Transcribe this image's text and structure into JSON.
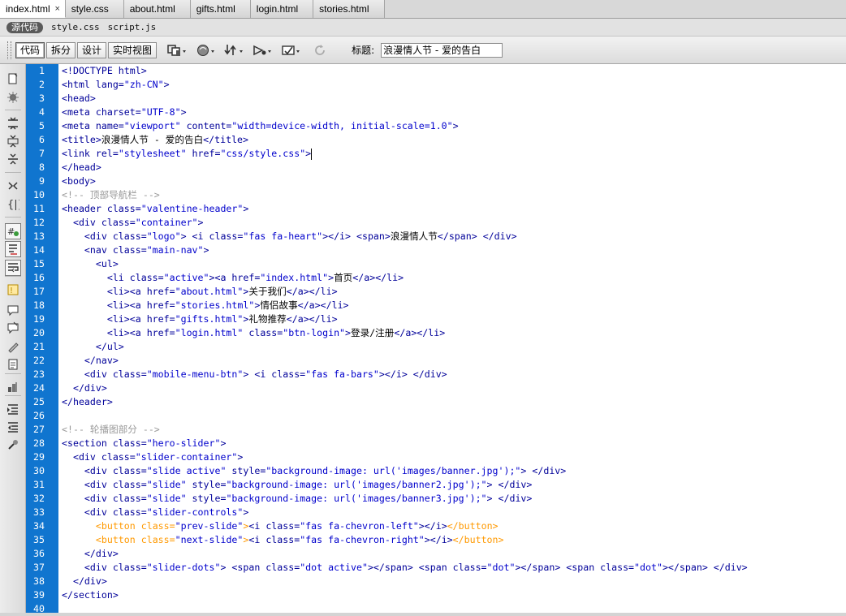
{
  "tabs": [
    {
      "label": "index.html",
      "active": true,
      "close": "×"
    },
    {
      "label": "style.css",
      "active": false
    },
    {
      "label": "about.html",
      "active": false
    },
    {
      "label": "gifts.html",
      "active": false
    },
    {
      "label": "login.html",
      "active": false
    },
    {
      "label": "stories.html",
      "active": false
    }
  ],
  "related_files": {
    "source_label": "源代码",
    "files": [
      "style.css",
      "script.js"
    ]
  },
  "toolbar": {
    "view_buttons": [
      "代码",
      "拆分",
      "设计",
      "实时视图"
    ],
    "active_view": "代码",
    "icons": [
      "multiscreen-icon",
      "preview-browser-icon",
      "file-management-icon",
      "visual-aids-icon",
      "validate-icon",
      "refresh-icon"
    ],
    "title_label": "标题:",
    "title_value": "浪漫情人节 - 爱的告白"
  },
  "sidebar_icons": [
    "open-documents-icon",
    "collapse-tag-icon",
    "collapse-selection-icon",
    "expand-all-icon",
    "expand-collapse-icon",
    "select-parent-tag-icon",
    "balance-braces-icon",
    "line-numbers-icon",
    "highlight-invalid-icon",
    "word-wrap-icon",
    "syntax-error-icon",
    "apply-comment-icon",
    "remove-comment-icon",
    "wrap-tag-icon",
    "recent-snippets-icon",
    "move-css-icon",
    "indent-icon",
    "outdent-icon",
    "format-source-icon"
  ],
  "colors": {
    "gutter": "#1075cf",
    "tag": "#000099",
    "attr_value": "#0000cc",
    "comment": "#999999",
    "form_tag": "#ff9900"
  },
  "code_lines": [
    [
      [
        "tag",
        "<!DOCTYPE html>"
      ]
    ],
    [
      [
        "tag",
        "<html lang="
      ],
      [
        "val",
        "\"zh-CN\""
      ],
      [
        "tag",
        ">"
      ]
    ],
    [
      [
        "tag",
        "<head>"
      ]
    ],
    [
      [
        "tag",
        "<meta charset="
      ],
      [
        "val",
        "\"UTF-8\""
      ],
      [
        "tag",
        ">"
      ]
    ],
    [
      [
        "tag",
        "<meta name="
      ],
      [
        "val",
        "\"viewport\""
      ],
      [
        "tag",
        " content="
      ],
      [
        "val",
        "\"width=device-width, initial-scale=1.0\""
      ],
      [
        "tag",
        ">"
      ]
    ],
    [
      [
        "tag",
        "<title>"
      ],
      [
        "txt",
        "浪漫情人节 - 爱的告白"
      ],
      [
        "tag",
        "</title>"
      ]
    ],
    [
      [
        "tag",
        "<link rel="
      ],
      [
        "val",
        "\"stylesheet\""
      ],
      [
        "tag",
        " href="
      ],
      [
        "val",
        "\"css/style.css\""
      ],
      [
        "tag",
        ">"
      ]
    ],
    [
      [
        "tag",
        "</head>"
      ]
    ],
    [
      [
        "tag",
        "<body>"
      ]
    ],
    [
      [
        "cmt",
        "<!-- 顶部导航栏 -->"
      ]
    ],
    [
      [
        "tag",
        "<header class="
      ],
      [
        "val",
        "\"valentine-header\""
      ],
      [
        "tag",
        ">"
      ]
    ],
    [
      [
        "txt",
        "  "
      ],
      [
        "tag",
        "<div class="
      ],
      [
        "val",
        "\"container\""
      ],
      [
        "tag",
        ">"
      ]
    ],
    [
      [
        "txt",
        "    "
      ],
      [
        "tag",
        "<div class="
      ],
      [
        "val",
        "\"logo\""
      ],
      [
        "tag",
        "> <i class="
      ],
      [
        "val",
        "\"fas fa-heart\""
      ],
      [
        "tag",
        "></i> <span>"
      ],
      [
        "txt",
        "浪漫情人节"
      ],
      [
        "tag",
        "</span> </div>"
      ]
    ],
    [
      [
        "txt",
        "    "
      ],
      [
        "tag",
        "<nav class="
      ],
      [
        "val",
        "\"main-nav\""
      ],
      [
        "tag",
        ">"
      ]
    ],
    [
      [
        "txt",
        "      "
      ],
      [
        "tag",
        "<ul>"
      ]
    ],
    [
      [
        "txt",
        "        "
      ],
      [
        "tag",
        "<li class="
      ],
      [
        "val",
        "\"active\""
      ],
      [
        "tag",
        "><a href="
      ],
      [
        "val",
        "\"index.html\""
      ],
      [
        "tag",
        ">"
      ],
      [
        "txt",
        "首页"
      ],
      [
        "tag",
        "</a></li>"
      ]
    ],
    [
      [
        "txt",
        "        "
      ],
      [
        "tag",
        "<li><a href="
      ],
      [
        "val",
        "\"about.html\""
      ],
      [
        "tag",
        ">"
      ],
      [
        "txt",
        "关于我们"
      ],
      [
        "tag",
        "</a></li>"
      ]
    ],
    [
      [
        "txt",
        "        "
      ],
      [
        "tag",
        "<li><a href="
      ],
      [
        "val",
        "\"stories.html\""
      ],
      [
        "tag",
        ">"
      ],
      [
        "txt",
        "情侣故事"
      ],
      [
        "tag",
        "</a></li>"
      ]
    ],
    [
      [
        "txt",
        "        "
      ],
      [
        "tag",
        "<li><a href="
      ],
      [
        "val",
        "\"gifts.html\""
      ],
      [
        "tag",
        ">"
      ],
      [
        "txt",
        "礼物推荐"
      ],
      [
        "tag",
        "</a></li>"
      ]
    ],
    [
      [
        "txt",
        "        "
      ],
      [
        "tag",
        "<li><a href="
      ],
      [
        "val",
        "\"login.html\""
      ],
      [
        "tag",
        " class="
      ],
      [
        "val",
        "\"btn-login\""
      ],
      [
        "tag",
        ">"
      ],
      [
        "txt",
        "登录/注册"
      ],
      [
        "tag",
        "</a></li>"
      ]
    ],
    [
      [
        "txt",
        "      "
      ],
      [
        "tag",
        "</ul>"
      ]
    ],
    [
      [
        "txt",
        "    "
      ],
      [
        "tag",
        "</nav>"
      ]
    ],
    [
      [
        "txt",
        "    "
      ],
      [
        "tag",
        "<div class="
      ],
      [
        "val",
        "\"mobile-menu-btn\""
      ],
      [
        "tag",
        "> <i class="
      ],
      [
        "val",
        "\"fas fa-bars\""
      ],
      [
        "tag",
        "></i> </div>"
      ]
    ],
    [
      [
        "txt",
        "  "
      ],
      [
        "tag",
        "</div>"
      ]
    ],
    [
      [
        "tag",
        "</header>"
      ]
    ],
    [],
    [
      [
        "cmt",
        "<!-- 轮播图部分 -->"
      ]
    ],
    [
      [
        "tag",
        "<section class="
      ],
      [
        "val",
        "\"hero-slider\""
      ],
      [
        "tag",
        ">"
      ]
    ],
    [
      [
        "txt",
        "  "
      ],
      [
        "tag",
        "<div class="
      ],
      [
        "val",
        "\"slider-container\""
      ],
      [
        "tag",
        ">"
      ]
    ],
    [
      [
        "txt",
        "    "
      ],
      [
        "tag",
        "<div class="
      ],
      [
        "val",
        "\"slide active\""
      ],
      [
        "tag",
        " style="
      ],
      [
        "val",
        "\"background-image: url('images/banner.jpg');\""
      ],
      [
        "tag",
        "> </div>"
      ]
    ],
    [
      [
        "txt",
        "    "
      ],
      [
        "tag",
        "<div class="
      ],
      [
        "val",
        "\"slide\""
      ],
      [
        "tag",
        " style="
      ],
      [
        "val",
        "\"background-image: url('images/banner2.jpg');\""
      ],
      [
        "tag",
        "> </div>"
      ]
    ],
    [
      [
        "txt",
        "    "
      ],
      [
        "tag",
        "<div class="
      ],
      [
        "val",
        "\"slide\""
      ],
      [
        "tag",
        " style="
      ],
      [
        "val",
        "\"background-image: url('images/banner3.jpg');\""
      ],
      [
        "tag",
        "> </div>"
      ]
    ],
    [
      [
        "txt",
        "    "
      ],
      [
        "tag",
        "<div class="
      ],
      [
        "val",
        "\"slider-controls\""
      ],
      [
        "tag",
        ">"
      ]
    ],
    [
      [
        "txt",
        "      "
      ],
      [
        "btn",
        "<button class="
      ],
      [
        "val",
        "\"prev-slide\""
      ],
      [
        "btn",
        ">"
      ],
      [
        "tag",
        "<i class="
      ],
      [
        "val",
        "\"fas fa-chevron-left\""
      ],
      [
        "tag",
        "></i>"
      ],
      [
        "btn",
        "</button>"
      ]
    ],
    [
      [
        "txt",
        "      "
      ],
      [
        "btn",
        "<button class="
      ],
      [
        "val",
        "\"next-slide\""
      ],
      [
        "btn",
        ">"
      ],
      [
        "tag",
        "<i class="
      ],
      [
        "val",
        "\"fas fa-chevron-right\""
      ],
      [
        "tag",
        "></i>"
      ],
      [
        "btn",
        "</button>"
      ]
    ],
    [
      [
        "txt",
        "    "
      ],
      [
        "tag",
        "</div>"
      ]
    ],
    [
      [
        "txt",
        "    "
      ],
      [
        "tag",
        "<div class="
      ],
      [
        "val",
        "\"slider-dots\""
      ],
      [
        "tag",
        "> <span class="
      ],
      [
        "val",
        "\"dot active\""
      ],
      [
        "tag",
        "></span> <span class="
      ],
      [
        "val",
        "\"dot\""
      ],
      [
        "tag",
        "></span> <span class="
      ],
      [
        "val",
        "\"dot\""
      ],
      [
        "tag",
        "></span> </div>"
      ]
    ],
    [
      [
        "txt",
        "  "
      ],
      [
        "tag",
        "</div>"
      ]
    ],
    [
      [
        "tag",
        "</section>"
      ]
    ],
    []
  ],
  "cursor_line": 7
}
